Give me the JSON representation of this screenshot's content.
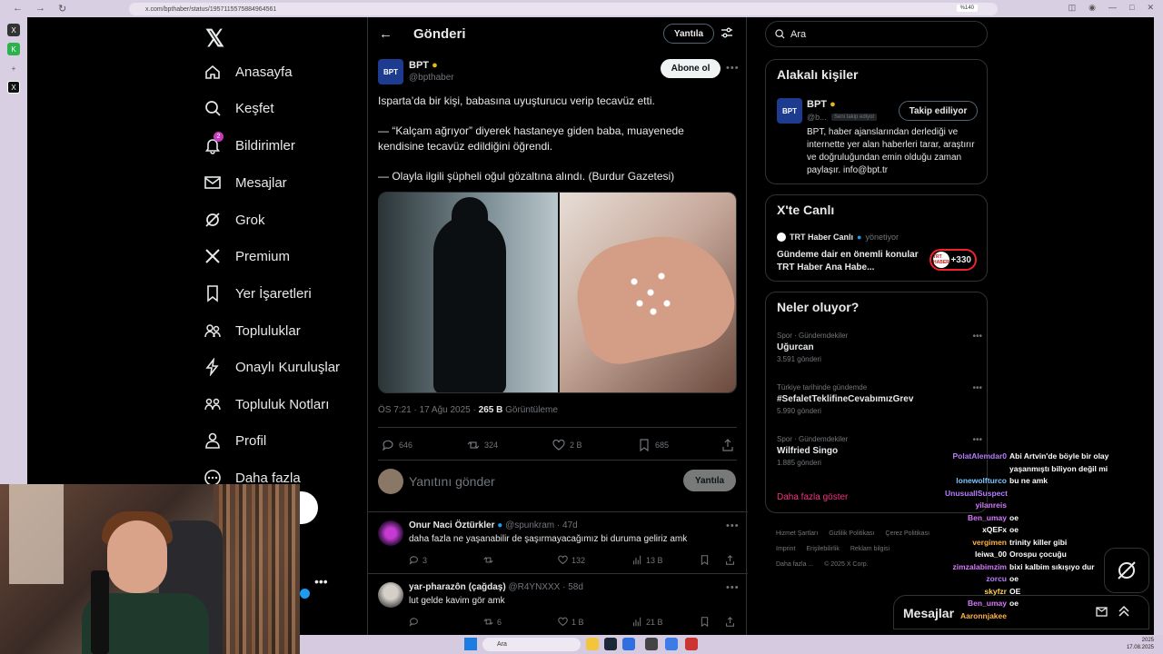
{
  "browser": {
    "url": "x.com/bpthaber/status/1957115575884964561",
    "zoom": "%140"
  },
  "nav": {
    "items": [
      {
        "label": "Anasayfa",
        "icon": "home-icon"
      },
      {
        "label": "Keşfet",
        "icon": "search-icon"
      },
      {
        "label": "Bildirimler",
        "icon": "bell-icon",
        "badge": "2"
      },
      {
        "label": "Mesajlar",
        "icon": "mail-icon"
      },
      {
        "label": "Grok",
        "icon": "grok-icon"
      },
      {
        "label": "Premium",
        "icon": "x-icon"
      },
      {
        "label": "Yer İşaretleri",
        "icon": "bookmark-icon"
      },
      {
        "label": "Topluluklar",
        "icon": "communities-icon"
      },
      {
        "label": "Onaylı Kuruluşlar",
        "icon": "lightning-icon"
      },
      {
        "label": "Topluluk Notları",
        "icon": "notes-icon"
      },
      {
        "label": "Profil",
        "icon": "profile-icon"
      },
      {
        "label": "Daha fazla",
        "icon": "more-icon"
      }
    ],
    "post_button_partial": "la"
  },
  "header": {
    "title": "Gönderi",
    "reply_pill": "Yantıla"
  },
  "tweet": {
    "avatar_text": "BPT",
    "author": "BPT",
    "handle": "@bpthaber",
    "follow": "Abone ol",
    "line1": "Isparta’da bir kişi, babasına uyuşturucu verip tecavüz etti.",
    "line2": "— “Kalçam ağrıyor” diyerek hastaneye giden baba, muayenede kendisine tecavüz edildiğini öğrendi.",
    "line3": "— Olayla ilgili şüpheli oğul gözaltına alındı. (Burdur Gazetesi)",
    "time": "ÖS 7:21 · 17 Ağu 2025 · ",
    "views_count": "265 B",
    "views_label": " Görüntüleme",
    "replies": "646",
    "retweets": "324",
    "likes": "2 B",
    "bookmarks": "685"
  },
  "compose": {
    "placeholder": "Yanıtını gönder",
    "button": "Yantıla"
  },
  "replies": [
    {
      "name": "Onur Naci Öztürkler",
      "handle": "@spunkram · 47d",
      "text": "daha fazla ne yaşanabilir de şaşırmayacağımız bi duruma geliriz amk",
      "replies": "3",
      "likes": "132",
      "views": "13 B"
    },
    {
      "name": "yar-pharazôn (çağdaş)",
      "handle": "@R4YNXXX · 58d",
      "text": "lut gelde kavim gör amk",
      "replies": "",
      "retweets": "6",
      "likes": "1 B",
      "views": "21 B"
    }
  ],
  "right": {
    "search_placeholder": "Ara",
    "related_title": "Alakalı kişiler",
    "related": {
      "name": "BPT",
      "handle": "@b...",
      "follows_you": "Seni takip ediyor",
      "button": "Takip ediliyor",
      "bio": "BPT, haber ajanslarından derlediği ve internette yer alan haberleri tarar, araştırır ve doğruluğundan emin olduğu zaman paylaşır. info@bpt.tr"
    },
    "live_title": "X'te Canlı",
    "live": {
      "host": "TRT Haber Canlı",
      "role": "yönetiyor",
      "title": "Gündeme dair en önemli konular TRT Haber Ana Habe...",
      "logo": "TRT HABER",
      "count": "+330"
    },
    "trends_title": "Neler oluyor?",
    "trends": [
      {
        "category": "Spor · Gündemdekiler",
        "topic": "Uğurcan",
        "count": "3.591 gönderi"
      },
      {
        "category": "Türkiye tarihinde gündemde",
        "topic": "#SefaletTeklifineCevabımızGrev",
        "count": "5.990 gönderi"
      },
      {
        "category": "Spor · Gündemdekiler",
        "topic": "Wilfried Singo",
        "count": "1.885 gönderi"
      }
    ],
    "show_more": "Daha fazla göster",
    "footer": [
      "Hizmet Şartları",
      "Gizlilik Politikası",
      "Çerez Politikası",
      "Imprint",
      "Erişilebilirlik",
      "Reklam bilgisi",
      "Daha fazla ...",
      "© 2025 X Corp."
    ]
  },
  "messages_bar": {
    "title": "Mesajlar"
  },
  "chat": [
    {
      "user": "PolatAlemdar0",
      "msg": "Abi Artvin'de böyle bir olay",
      "color": "#b77dfb"
    },
    {
      "user": "",
      "msg": "yaşanmıştı biliyon değil mi",
      "color": "#b77dfb"
    },
    {
      "user": "lonewolfturco",
      "msg": "bu ne amk",
      "color": "#7fc6ff"
    },
    {
      "user": "UnusuallSuspect",
      "msg": "",
      "color": "#b77dfb"
    },
    {
      "user": "yilanreis",
      "msg": "",
      "color": "#d879ff"
    },
    {
      "user": "Ben_umay",
      "msg": "oe",
      "color": "#d879ff"
    },
    {
      "user": "xQEFx",
      "msg": "oe",
      "color": "#ffffff"
    },
    {
      "user": "vergimen",
      "msg": "trinity killer gibi",
      "color": "#ffb347"
    },
    {
      "user": "leiwa_00",
      "msg": "Orospu çocuğu",
      "color": "#ffffff"
    },
    {
      "user": "zimzalabimzim",
      "msg": "bixi kalbim sıkışıyo dur",
      "color": "#d879ff"
    },
    {
      "user": "zorcu",
      "msg": "oe",
      "color": "#b77dfb"
    },
    {
      "user": "skyfzr",
      "msg": "OE",
      "color": "#ffd25a"
    },
    {
      "user": "Ben_umay",
      "msg": "oe",
      "color": "#d879ff"
    },
    {
      "user": "Aaronnjakee",
      "msg": "",
      "color": "#ffb347"
    }
  ],
  "taskbar": {
    "search": "Ara",
    "time": "2025",
    "date": "17.08.2025"
  }
}
